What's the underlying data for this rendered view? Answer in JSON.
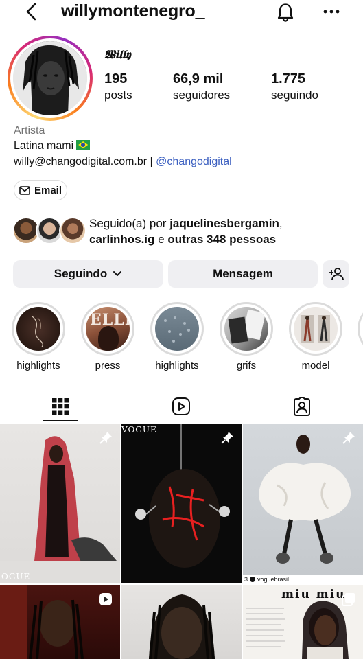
{
  "header": {
    "username": "willymontenegro_",
    "icons": [
      "chevron-left-icon",
      "bell-icon",
      "more-icon"
    ]
  },
  "profile": {
    "display_name": "𝖂𝖎𝖑𝖑𝖞",
    "stats": [
      {
        "value": "195",
        "label": "posts"
      },
      {
        "value": "66,9 mil",
        "label": "seguidores"
      },
      {
        "value": "1.775",
        "label": "seguindo"
      }
    ],
    "category": "Artista",
    "bio_line1": "Latina mami",
    "bio_email": "willy@changodigital.com.br | ",
    "bio_mention": "@changodigital",
    "ring_colors": [
      "#feda75",
      "#fa7e1e",
      "#d62976",
      "#962fbf"
    ]
  },
  "contact": {
    "email_label": "Email"
  },
  "followed_by": {
    "prefix": "Seguido(a) por ",
    "user1": "jaquelinesbergamin",
    "sep": ",",
    "user2": "carlinhos.ig",
    "middle": " e ",
    "others": "outras 348 pessoas"
  },
  "actions": {
    "following_label": "Seguindo",
    "message_label": "Mensagem"
  },
  "highlights": [
    {
      "label": "highlights"
    },
    {
      "label": "press",
      "overlay": "ELLE"
    },
    {
      "label": "highlights"
    },
    {
      "label": "grifs"
    },
    {
      "label": "model"
    }
  ],
  "tabs": [
    "grid-icon",
    "reels-icon",
    "tagged-icon"
  ],
  "posts": {
    "captions": [
      "OGUE",
      "VOGUE",
      "voguebrasil",
      "miu miu"
    ],
    "vogue_badge_prefix": "3"
  },
  "colors": {
    "mention": "#3b5fc0",
    "muted": "#737373",
    "button_bg": "#efeff2",
    "border": "#dbdbdb"
  }
}
